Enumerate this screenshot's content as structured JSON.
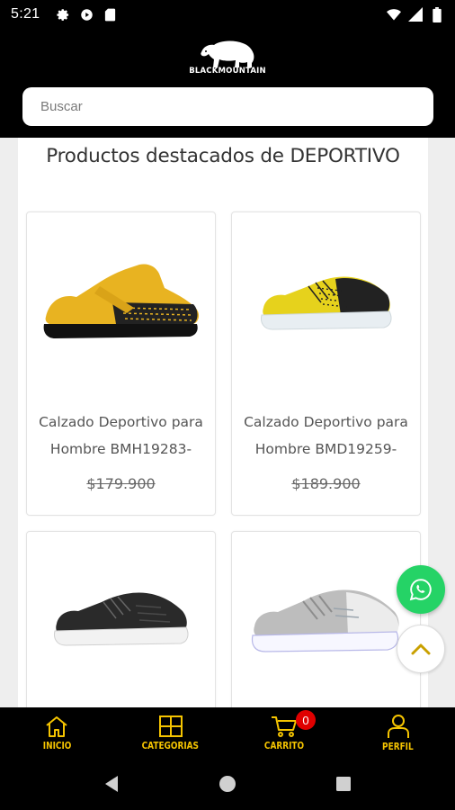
{
  "status_bar": {
    "time": "5:21",
    "left_icons": [
      "gear-icon",
      "play-icon",
      "sd-card-icon"
    ],
    "right_icons": [
      "wifi-icon",
      "signal-icon",
      "battery-icon"
    ]
  },
  "header": {
    "brand": "BLACKMOUNTAIN",
    "search": {
      "placeholder": "Buscar",
      "value": ""
    }
  },
  "section": {
    "title": "Productos destacados de DEPORTIVO"
  },
  "products": [
    {
      "name_line1": "Calzado Deportivo para",
      "name_line2": "Hombre BMH19283-",
      "price": "$179.900",
      "shoe_color": "#e8b321"
    },
    {
      "name_line1": "Calzado Deportivo para",
      "name_line2": "Hombre BMD19259-",
      "price": "$189.900",
      "shoe_color": "#e6d21c"
    },
    {
      "name_line1": "",
      "name_line2": "",
      "price": "",
      "shoe_color": "#2a2a2a"
    },
    {
      "name_line1": "",
      "name_line2": "",
      "price": "",
      "shoe_color": "#bdbdbd"
    }
  ],
  "floating": {
    "whatsapp_icon": "whatsapp-icon",
    "scroll_up_icon": "chevron-up-icon"
  },
  "bottom_nav": {
    "items": [
      {
        "label": "INICIO",
        "icon": "home-icon"
      },
      {
        "label": "CATEGORIAS",
        "icon": "grid-icon"
      },
      {
        "label": "CARRITO",
        "icon": "cart-icon"
      },
      {
        "label": "PERFIL",
        "icon": "user-icon"
      }
    ],
    "cart_count": "0"
  },
  "colors": {
    "accent": "#f5c400",
    "whatsapp": "#25d366",
    "badge": "#e00000"
  }
}
